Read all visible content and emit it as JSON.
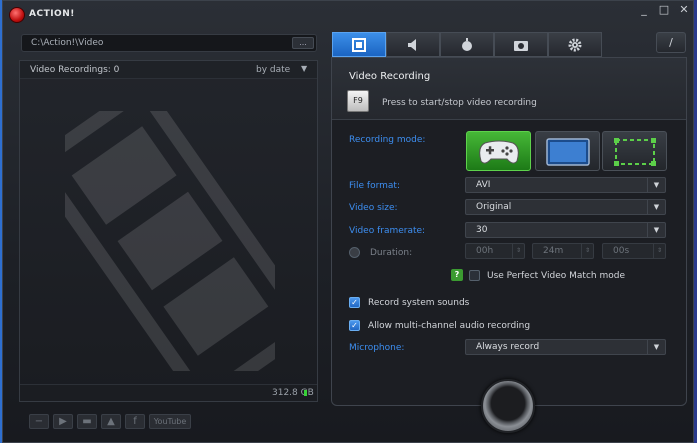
{
  "window": {
    "title": "ACTION!",
    "controls": {
      "minimize": "_",
      "maximize": "□",
      "close": "✕"
    }
  },
  "path": {
    "value": "C:\\Action!\\Video",
    "browse_label": "..."
  },
  "recordings": {
    "count_label": "Video Recordings: 0",
    "sort_label": "by date",
    "disk_free": "312.8 GB"
  },
  "bottom_toolbar": {
    "youtube_label": "YouTube"
  },
  "tabs": [
    {
      "name": "video",
      "icon": "film-icon",
      "active": true
    },
    {
      "name": "audio",
      "icon": "speaker-icon",
      "active": false
    },
    {
      "name": "benchmark",
      "icon": "stopwatch-icon",
      "active": false
    },
    {
      "name": "screenshot",
      "icon": "camera-icon",
      "active": false
    },
    {
      "name": "settings",
      "icon": "gear-icon",
      "active": false
    }
  ],
  "video_recording": {
    "title": "Video Recording",
    "hotkey": "F9",
    "hotkey_hint": "Press to start/stop video recording"
  },
  "form": {
    "recording_mode_label": "Recording mode:",
    "modes": [
      {
        "name": "game",
        "icon": "gamepad-icon",
        "active": true
      },
      {
        "name": "desktop",
        "icon": "monitor-icon",
        "active": false
      },
      {
        "name": "region",
        "icon": "region-select-icon",
        "active": false
      }
    ],
    "file_format_label": "File format:",
    "file_format": "AVI",
    "video_size_label": "Video size:",
    "video_size": "Original",
    "framerate_label": "Video framerate:",
    "framerate": "30",
    "duration_label": "Duration:",
    "duration_hours": "00h",
    "duration_minutes": "24m",
    "duration_seconds": "00s",
    "perfect_match_label": "Use Perfect Video Match mode",
    "record_system_sounds_label": "Record system sounds",
    "multichannel_label": "Allow multi-channel audio recording",
    "microphone_label": "Microphone:",
    "microphone": "Always record"
  },
  "colors": {
    "accent": "#3d8ef0",
    "active_mode": "#3aa82e",
    "record_led": "#38d238"
  }
}
